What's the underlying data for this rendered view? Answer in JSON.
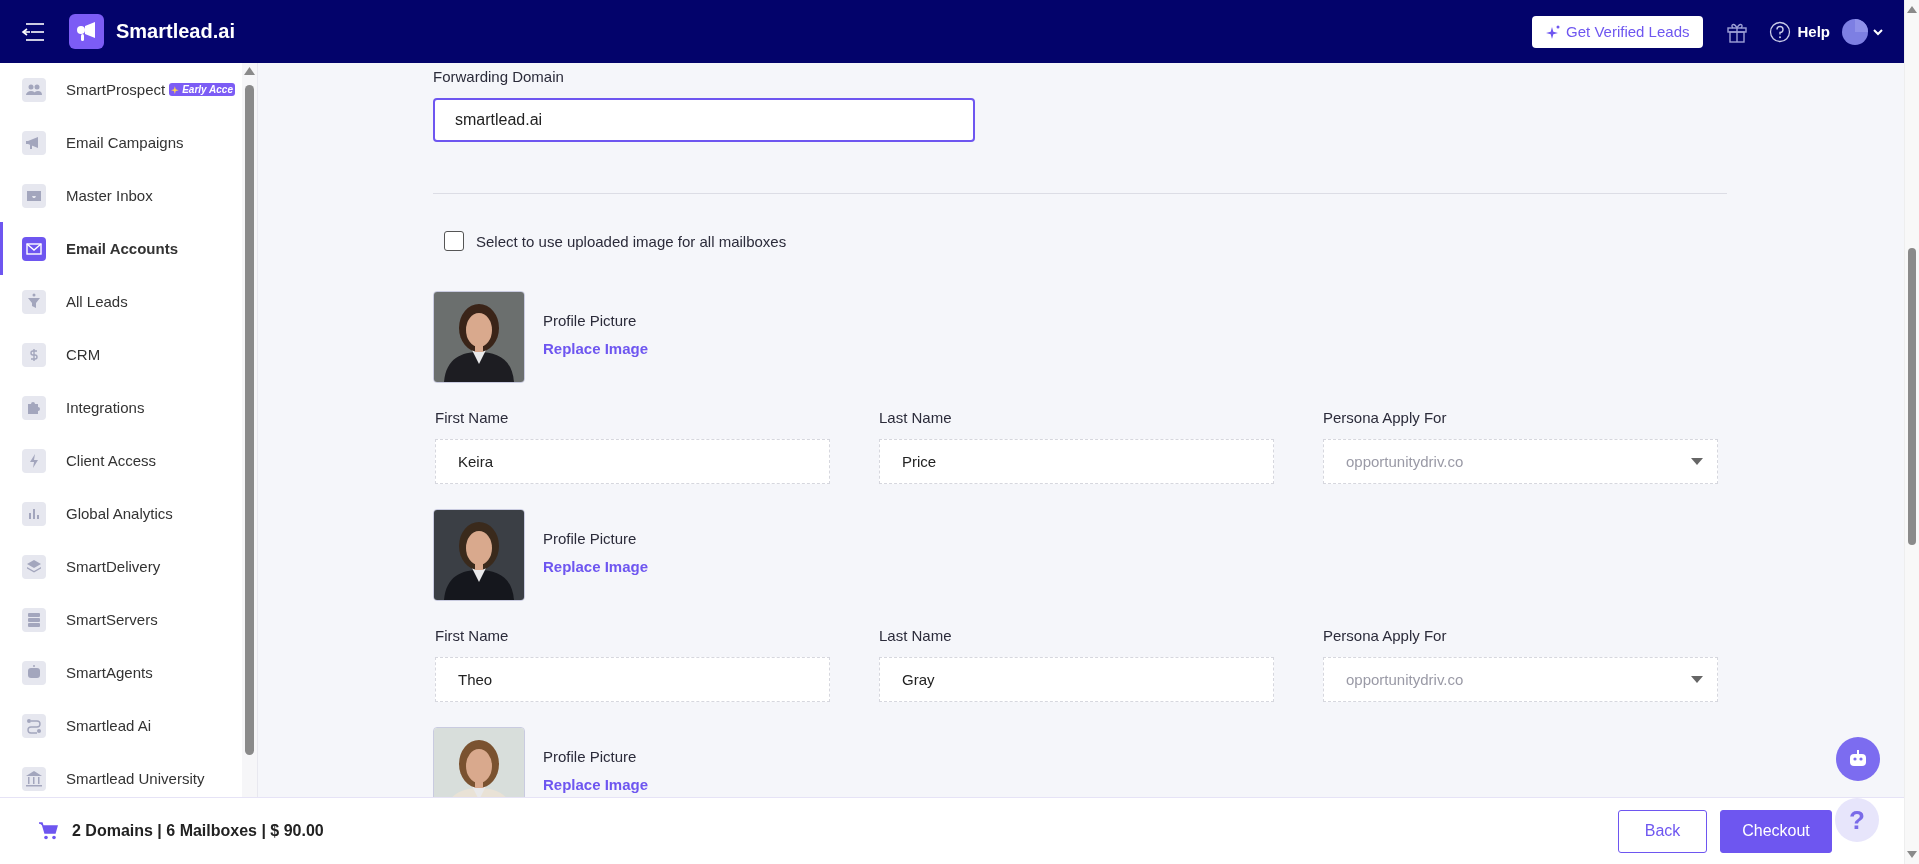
{
  "header": {
    "brand": "Smartlead.ai",
    "cta": "Get Verified Leads",
    "help": "Help"
  },
  "sidebar": {
    "items": [
      {
        "label": "SmartProspect",
        "badge": "Early Acce",
        "selected": false
      },
      {
        "label": "Email Campaigns",
        "selected": false
      },
      {
        "label": "Master Inbox",
        "selected": false
      },
      {
        "label": "Email Accounts",
        "selected": true
      },
      {
        "label": "All Leads",
        "selected": false
      },
      {
        "label": "CRM",
        "selected": false
      },
      {
        "label": "Integrations",
        "selected": false
      },
      {
        "label": "Client Access",
        "selected": false
      },
      {
        "label": "Global Analytics",
        "selected": false
      },
      {
        "label": "SmartDelivery",
        "selected": false
      },
      {
        "label": "SmartServers",
        "selected": false
      },
      {
        "label": "SmartAgents",
        "selected": false
      },
      {
        "label": "Smartlead Ai",
        "selected": false
      },
      {
        "label": "Smartlead University",
        "selected": false
      }
    ]
  },
  "form": {
    "forwarding_domain": {
      "label": "Forwarding Domain",
      "value": "smartlead.ai",
      "focused": true
    },
    "use_uploaded_image": {
      "label": "Select to use uploaded image for all mailboxes",
      "checked": false
    },
    "mailboxes": [
      {
        "picture_label": "Profile Picture",
        "replace_link": "Replace Image",
        "first_name": {
          "label": "First Name",
          "value": "Keira"
        },
        "last_name": {
          "label": "Last Name",
          "value": "Price"
        },
        "persona": {
          "label": "Persona Apply For",
          "value": "opportunitydriv.co",
          "disabled": true
        }
      },
      {
        "picture_label": "Profile Picture",
        "replace_link": "Replace Image",
        "first_name": {
          "label": "First Name",
          "value": "Theo"
        },
        "last_name": {
          "label": "Last Name",
          "value": "Gray"
        },
        "persona": {
          "label": "Persona Apply For",
          "value": "opportunitydriv.co",
          "disabled": true
        }
      },
      {
        "picture_label": "Profile Picture",
        "replace_link": "Replace Image"
      }
    ]
  },
  "footer": {
    "summary": "2 Domains | 6 Mailboxes | $ 90.00",
    "buttons": [
      {
        "label": "Back",
        "kind": "outline"
      },
      {
        "label": "Checkout",
        "kind": "primary"
      }
    ]
  },
  "help_bubble": "?"
}
